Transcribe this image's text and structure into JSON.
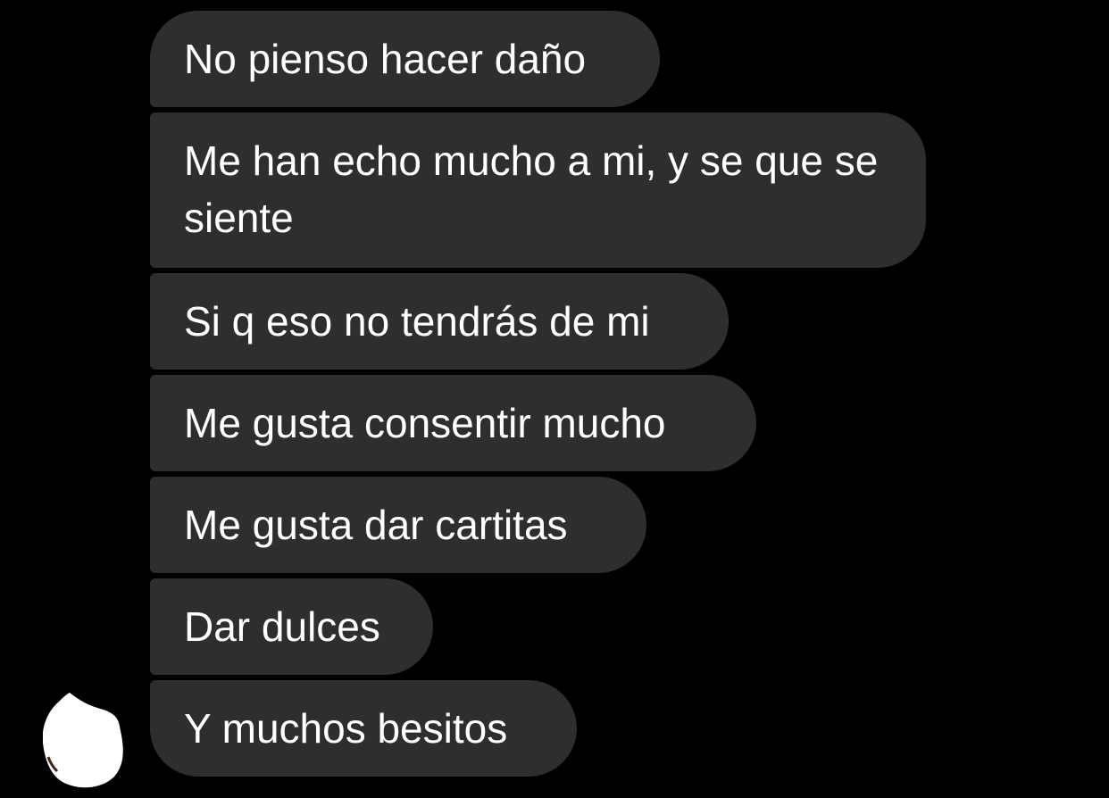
{
  "messages": [
    {
      "text": "No pienso hacer daño"
    },
    {
      "text": "Me han echo mucho a mi, y se que se siente"
    },
    {
      "text": "Si q eso no tendrás de mi"
    },
    {
      "text": "Me gusta consentir mucho"
    },
    {
      "text": "Me gusta dar cartitas"
    },
    {
      "text": "Dar dulces"
    },
    {
      "text": "Y muchos besitos"
    }
  ],
  "colors": {
    "background": "#000000",
    "bubble": "#2e2e2e",
    "text": "#ffffff",
    "avatar_mask": "#ffffff"
  },
  "avatar": {
    "icon": "redacted-avatar-icon"
  }
}
